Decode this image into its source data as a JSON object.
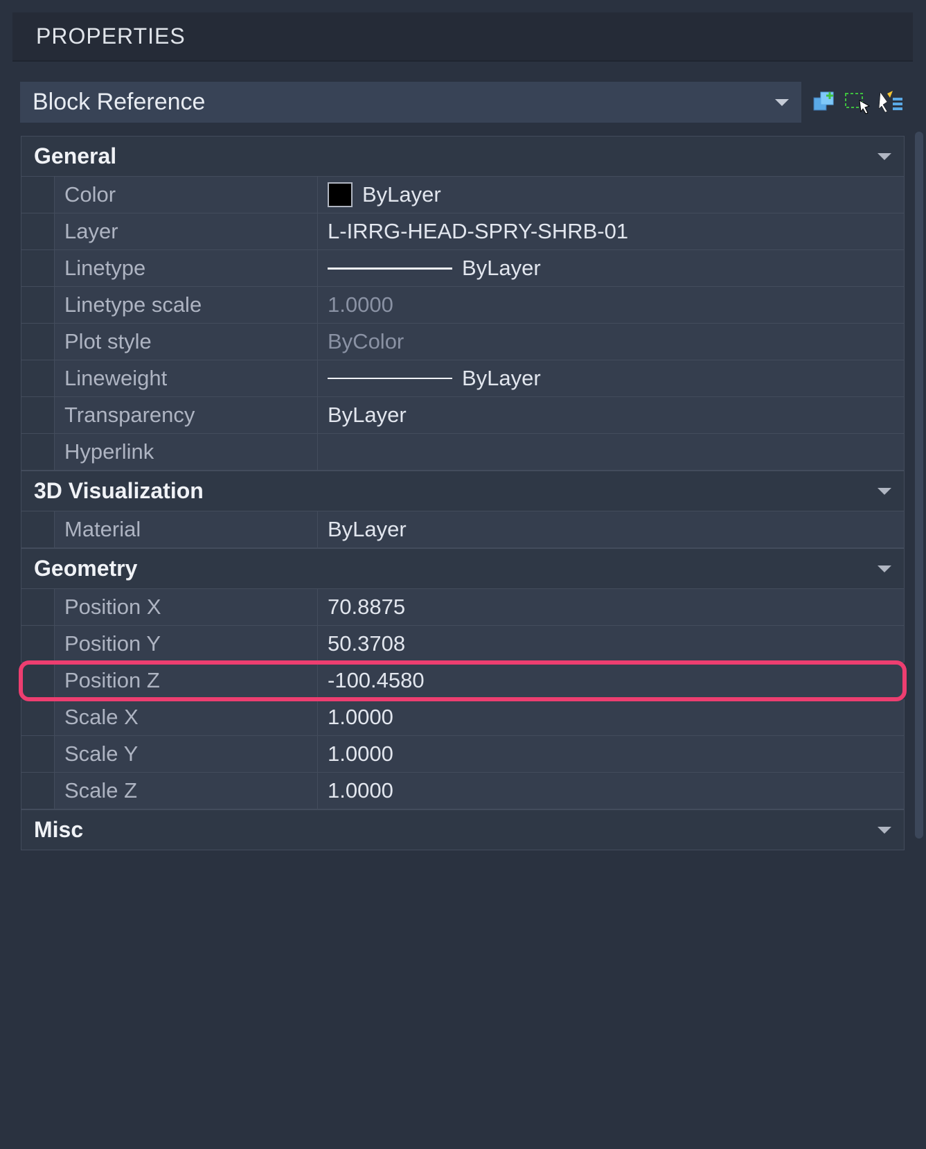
{
  "panel_title": "PROPERTIES",
  "selector": {
    "label": "Block Reference"
  },
  "sections": {
    "general": {
      "title": "General",
      "rows": {
        "color": {
          "label": "Color",
          "value": "ByLayer"
        },
        "layer": {
          "label": "Layer",
          "value": "L-IRRG-HEAD-SPRY-SHRB-01"
        },
        "linetype": {
          "label": "Linetype",
          "value": "ByLayer"
        },
        "linetype_scale": {
          "label": "Linetype scale",
          "value": "1.0000"
        },
        "plot_style": {
          "label": "Plot style",
          "value": "ByColor"
        },
        "lineweight": {
          "label": "Lineweight",
          "value": "ByLayer"
        },
        "transparency": {
          "label": "Transparency",
          "value": "ByLayer"
        },
        "hyperlink": {
          "label": "Hyperlink",
          "value": ""
        }
      }
    },
    "visualization": {
      "title": "3D Visualization",
      "rows": {
        "material": {
          "label": "Material",
          "value": "ByLayer"
        }
      }
    },
    "geometry": {
      "title": "Geometry",
      "rows": {
        "pos_x": {
          "label": "Position X",
          "value": "70.8875"
        },
        "pos_y": {
          "label": "Position Y",
          "value": "50.3708"
        },
        "pos_z": {
          "label": "Position Z",
          "value": "-100.4580"
        },
        "scale_x": {
          "label": "Scale X",
          "value": "1.0000"
        },
        "scale_y": {
          "label": "Scale Y",
          "value": "1.0000"
        },
        "scale_z": {
          "label": "Scale Z",
          "value": "1.0000"
        }
      }
    },
    "misc": {
      "title": "Misc"
    }
  }
}
